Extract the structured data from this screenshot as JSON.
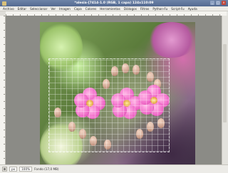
{
  "window": {
    "title": "*alesia-[7414-1.0 (RGB, 1 capa) 124x110:09"
  },
  "menubar": {
    "items": [
      "Archivo",
      "Editar",
      "Seleccionar",
      "Ver",
      "Imagen",
      "Capa",
      "Colores",
      "Herramientas",
      "Diálogos",
      "Filtros",
      "Python-Fu",
      "Script-Fu",
      "Ayuda"
    ]
  },
  "statusbar": {
    "units": "px",
    "zoom": "100%",
    "info": "Fondo (17,0 MB)"
  }
}
